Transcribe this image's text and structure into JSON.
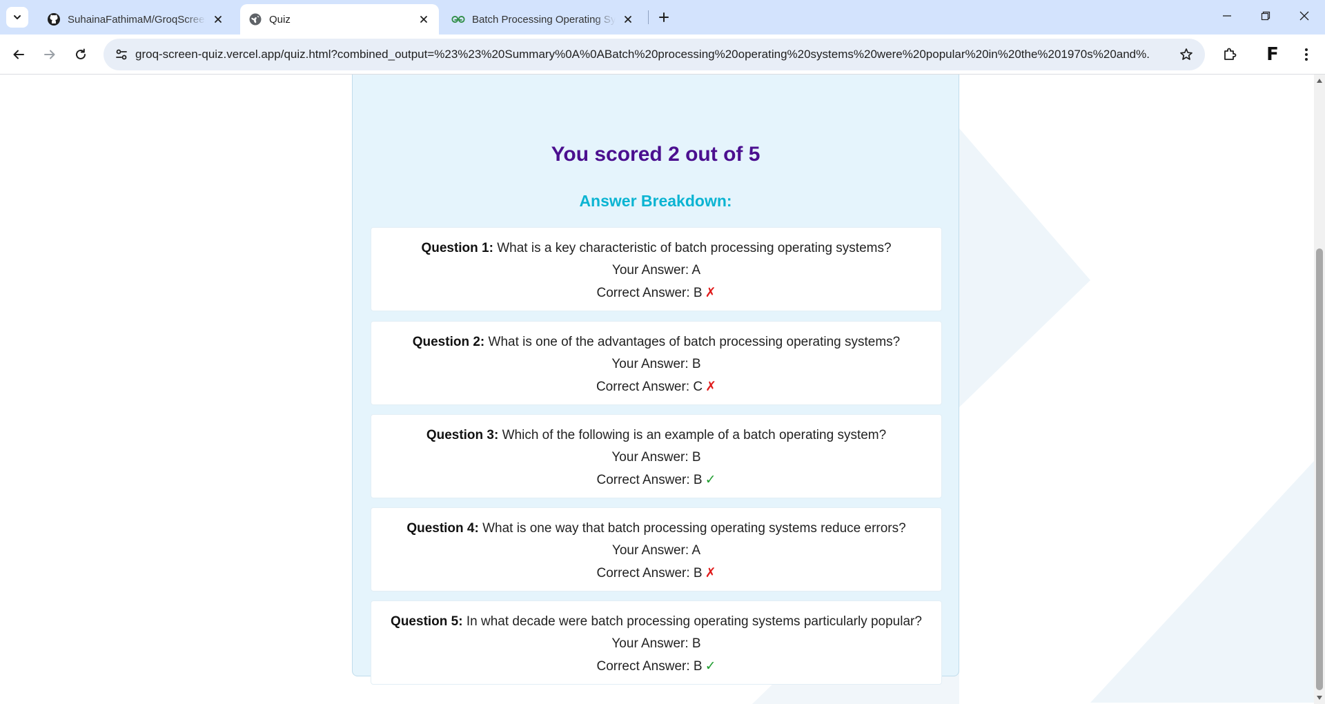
{
  "browser": {
    "tabs": [
      {
        "title": "SuhainaFathimaM/GroqScreen-Quiz",
        "icon": "github-icon",
        "active": false
      },
      {
        "title": "Quiz",
        "icon": "globe-icon",
        "active": true
      },
      {
        "title": "Batch Processing Operating Systems",
        "icon": "geeksforgeeks-icon",
        "active": false
      }
    ],
    "url_host": "groq-screen-quiz.vercel.app",
    "url_path": "/quiz.html?combined_output=%23%23%20Summary%0A%0ABatch%20processing%20operating%20systems%20were%20popular%20in%20the%201970s%20and%...",
    "profile_initial": "F"
  },
  "quiz": {
    "score_text": "You scored 2 out of 5",
    "breakdown_title": "Answer Breakdown:",
    "your_answer_label": "Your Answer:",
    "correct_answer_label": "Correct Answer:",
    "questions": [
      {
        "label": "Question 1:",
        "text": "What is a key characteristic of batch processing operating systems?",
        "your": "A",
        "correct": "B",
        "mark": "✗",
        "is_correct": false
      },
      {
        "label": "Question 2:",
        "text": "What is one of the advantages of batch processing operating systems?",
        "your": "B",
        "correct": "C",
        "mark": "✗",
        "is_correct": false
      },
      {
        "label": "Question 3:",
        "text": "Which of the following is an example of a batch operating system?",
        "your": "B",
        "correct": "B",
        "mark": "✓",
        "is_correct": true
      },
      {
        "label": "Question 4:",
        "text": "What is one way that batch processing operating systems reduce errors?",
        "your": "A",
        "correct": "B",
        "mark": "✗",
        "is_correct": false
      },
      {
        "label": "Question 5:",
        "text": "In what decade were batch processing operating systems particularly popular?",
        "your": "B",
        "correct": "B",
        "mark": "✓",
        "is_correct": true
      }
    ]
  },
  "colors": {
    "score": "#4b0f8f",
    "breakdown": "#0bb4d2",
    "card_bg": "#e5f4fc",
    "wrong": "#e01b1b",
    "right": "#1f9d2f",
    "tabstrip": "#d3e3fd"
  }
}
